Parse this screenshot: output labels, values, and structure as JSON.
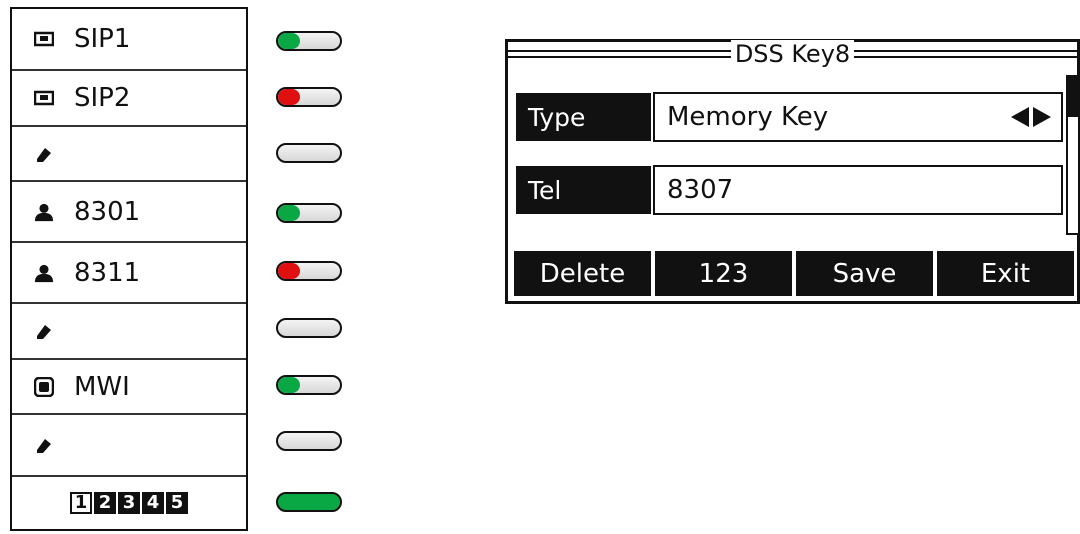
{
  "keys": [
    {
      "label": "SIP1",
      "icon": "line-icon"
    },
    {
      "label": "SIP2",
      "icon": "line-icon"
    },
    {
      "label": "",
      "icon": "pencil-icon"
    },
    {
      "label": "8301",
      "icon": "user-icon"
    },
    {
      "label": "8311",
      "icon": "user-icon"
    },
    {
      "label": "",
      "icon": "pencil-icon"
    },
    {
      "label": "MWI",
      "icon": "voicemail-icon"
    },
    {
      "label": "",
      "icon": "pencil-icon"
    }
  ],
  "pages": [
    "1",
    "2",
    "3",
    "4",
    "5"
  ],
  "active_page": "1",
  "leds": [
    {
      "state": "green-partial",
      "color": "#0aa845"
    },
    {
      "state": "red-partial",
      "color": "#e01010"
    },
    {
      "state": "off",
      "color": ""
    },
    {
      "state": "green-partial",
      "color": "#0aa845"
    },
    {
      "state": "red-partial",
      "color": "#e01010"
    },
    {
      "state": "off",
      "color": ""
    },
    {
      "state": "green-partial",
      "color": "#0aa845"
    },
    {
      "state": "off",
      "color": ""
    },
    {
      "state": "green-full",
      "color": "#0aa845"
    }
  ],
  "dialog": {
    "title": "DSS Key8",
    "fields": {
      "type_label": "Type",
      "type_value": "Memory Key",
      "tel_label": "Tel",
      "tel_value": "8307"
    },
    "softkeys": {
      "delete": "Delete",
      "input_mode": "123",
      "save": "Save",
      "exit": "Exit"
    }
  }
}
